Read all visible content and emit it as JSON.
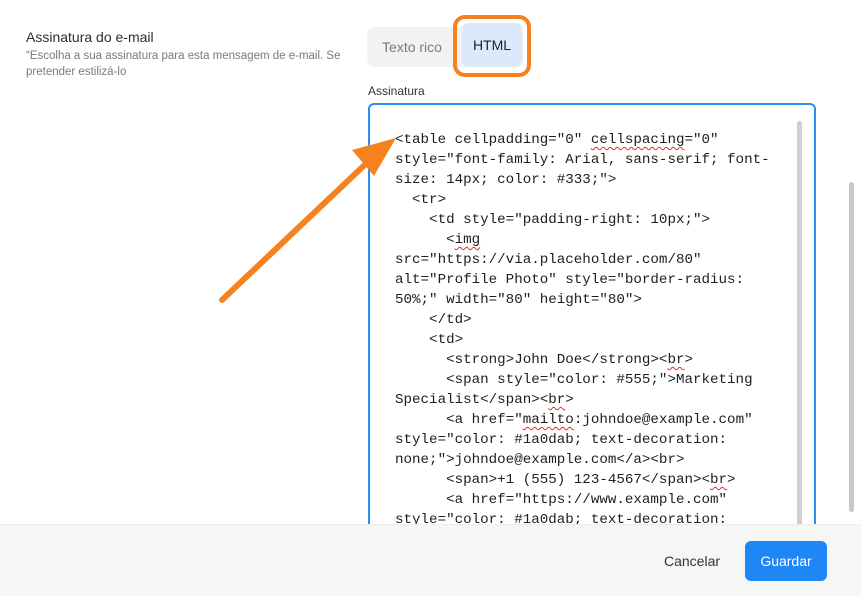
{
  "settings": {
    "title": "Assinatura do e-mail",
    "description": "“Escolha a sua assinatura para esta mensagem de e-mail. Se pretender estilizá-lo"
  },
  "tabs": [
    {
      "label": "Texto rico",
      "active": false
    },
    {
      "label": "HTML",
      "active": true
    }
  ],
  "editor": {
    "label": "Assinatura",
    "code_lines": [
      "<table cellpadding=\"0\" cellspacing=\"0\"",
      "style=\"font-family: Arial, sans-serif; font-",
      "size: 14px; color: #333;\">",
      "  <tr>",
      "    <td style=\"padding-right: 10px;\">",
      "      <img",
      "src=\"https://via.placeholder.com/80\"",
      "alt=\"Profile Photo\" style=\"border-radius:",
      "50%;\" width=\"80\" height=\"80\">",
      "    </td>",
      "    <td>",
      "      <strong>John Doe</strong><br>",
      "      <span style=\"color: #555;\">Marketing",
      "Specialist</span><br>",
      "      <a href=\"mailto:johndoe@example.com\"",
      "style=\"color: #1a0dab; text-decoration:",
      "none;\">johndoe@example.com</a><br>",
      "      <span>+1 (555) 123-4567</span><br>",
      "      <a href=\"https://www.example.com\"",
      "style=\"color: #1a0dab; text-decoration:"
    ]
  },
  "footer": {
    "cancel_label": "Cancelar",
    "save_label": "Guardar"
  },
  "colors": {
    "accent": "#1f86f5",
    "highlight": "#f5821f",
    "active_tab_bg": "#dbe9fb"
  }
}
